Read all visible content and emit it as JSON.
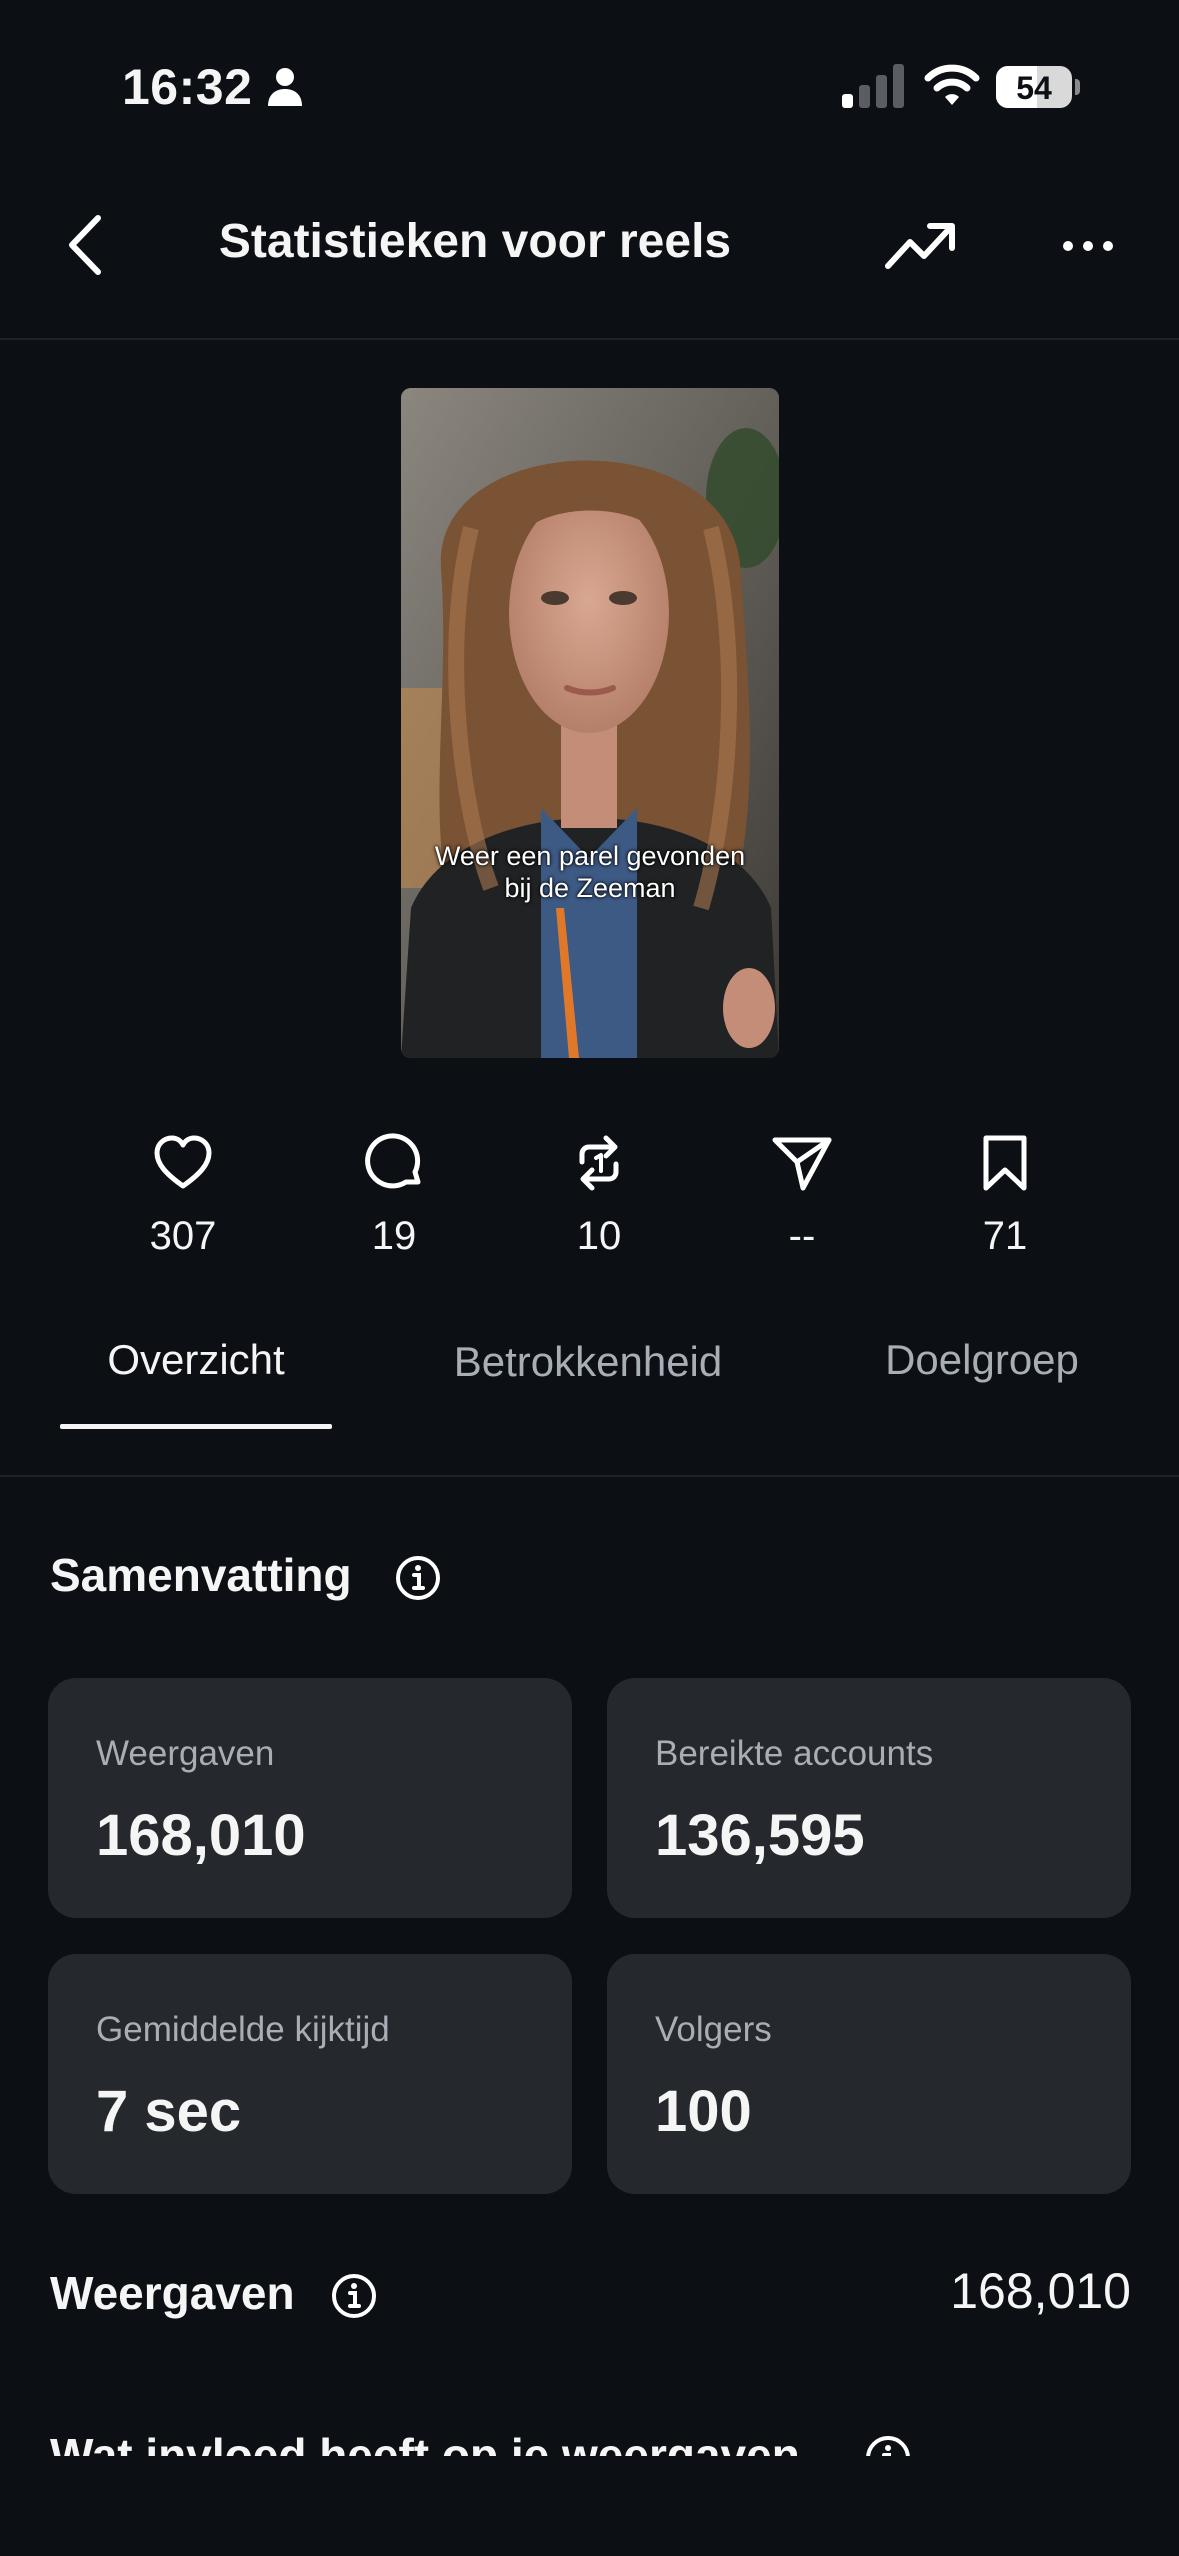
{
  "status_bar": {
    "time": "16:32",
    "battery": "54"
  },
  "nav": {
    "title": "Statistieken voor reels"
  },
  "reel": {
    "caption_line1": "Weer een parel gevonden",
    "caption_line2": "bij de Zeeman"
  },
  "metrics": {
    "likes": "307",
    "comments": "19",
    "reposts": "10",
    "shares": "--",
    "saves": "71"
  },
  "tabs": {
    "overview": "Overzicht",
    "engagement": "Betrokkenheid",
    "audience": "Doelgroep"
  },
  "summary": {
    "title": "Samenvatting",
    "cards": [
      {
        "label": "Weergaven",
        "value": "168,010"
      },
      {
        "label": "Bereikte accounts",
        "value": "136,595"
      },
      {
        "label": "Gemiddelde kijktijd",
        "value": "7 sec"
      },
      {
        "label": "Volgers",
        "value": "100"
      }
    ]
  },
  "views_section": {
    "title": "Weergaven",
    "total": "168,010"
  },
  "influence_section": {
    "title": "Wat invloed heeft op je weergaven"
  }
}
